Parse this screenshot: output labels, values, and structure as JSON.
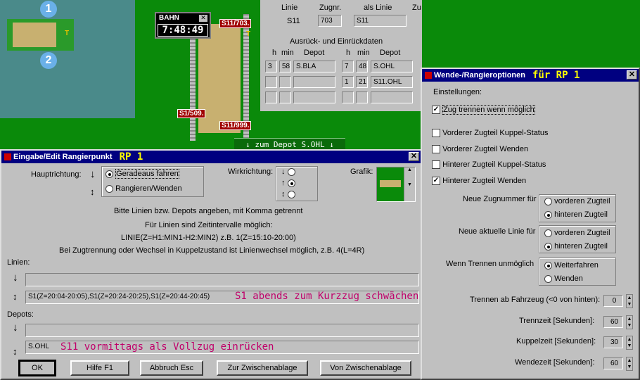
{
  "map": {
    "marker1": "1",
    "marker2": "2",
    "t1": "T",
    "t2": "T",
    "sig1": "S11/703.",
    "sig2": "S1/509.",
    "sig3": "S11/999."
  },
  "clock": {
    "title": "BAHN",
    "time": "7:48:49"
  },
  "depot_banner": "↓ zum Depot S.OHL ↓",
  "linie_panel": {
    "col_linie": "Linie",
    "col_zugnr": "Zugnr.",
    "col_als": "als Linie",
    "col_zu": "Zu",
    "linie_val": "S11",
    "zugnr_val": "703",
    "als_val": "S11",
    "ausruck_title": "Ausrück- und Einrückdaten",
    "h": "h",
    "min": "min",
    "depot": "Depot",
    "left_rows": [
      {
        "h": "3",
        "min": "58",
        "depot": "S.BLA"
      },
      {
        "h": "",
        "min": "",
        "depot": ""
      },
      {
        "h": "",
        "min": "",
        "depot": ""
      }
    ],
    "right_rows": [
      {
        "h": "7",
        "min": "48",
        "depot": "S.OHL"
      },
      {
        "h": "1",
        "min": "21",
        "depot": "S11.OHL"
      },
      {
        "h": "",
        "min": "",
        "depot": ""
      }
    ]
  },
  "edit": {
    "title": "Eingabe/Edit Rangierpunkt",
    "title_hl": "RP 1",
    "hauptrichtung": "Hauptrichtung:",
    "opt_gerade": "Geradeaus fahren",
    "opt_rangieren": "Rangieren/Wenden",
    "wirkrichtung": "Wirkrichtung:",
    "grafik": "Grafik:",
    "info1": "Bitte Linien bzw. Depots angeben, mit Komma getrennt",
    "info2": "Für Linien sind Zeitintervalle möglich:",
    "info3": "LINIE(Z=H1:MIN1-H2:MIN2) z.B. 1(Z=15:10-20:00)",
    "info4": "Bei Zugtrennung oder Wechsel in Kuppelzustand ist Linienwechsel möglich, z.B. 4(L=4R)",
    "linien_label": "Linien:",
    "linien_top": "",
    "linien_bottom": "S1(Z=20:04-20:05),S1(Z=20:24-20:25),S1(Z=20:44-20:45)",
    "linien_note": "S1 abends zum Kurzzug schwächen",
    "depots_label": "Depots:",
    "depots_top": "",
    "depots_bottom": "S.OHL",
    "depots_note": "S11 vormittags als Vollzug einrücken",
    "btn_ok": "OK",
    "btn_hilfe": "Hilfe     F1",
    "btn_abbruch": "Abbruch   Esc",
    "btn_zw": "Zur Zwischenablage",
    "btn_von": "Von Zwischenablage"
  },
  "wende": {
    "title": "Wende-/Rangieroptionen",
    "title_hl": "für RP 1",
    "einstellungen": "Einstellungen:",
    "chk_trennen": "Zug trennen wenn möglich",
    "chk_vorderer_kuppel": "Vorderer Zugteil Kuppel-Status",
    "chk_vorderer_wenden": "Vorderer Zugteil Wenden",
    "chk_hinterer_kuppel": "Hinterer Zugteil Kuppel-Status",
    "chk_hinterer_wenden": "Hinterer Zugteil Wenden",
    "zugnr_label": "Neue Zugnummer für",
    "zugnr_opt1": "vorderen Zugteil",
    "zugnr_opt2": "hinteren Zugteil",
    "linie_label": "Neue aktuelle Linie für",
    "linie_opt1": "vorderen Zugteil",
    "linie_opt2": "hinteren Zugteil",
    "unmoeglich_label": "Wenn Trennen unmöglich",
    "unm_opt1": "Weiterfahren",
    "unm_opt2": "Wenden",
    "trennen_ab": "Trennen ab Fahrzeug (<0 von hinten):",
    "trennen_ab_val": "0",
    "trennzeit": "Trennzeit  [Sekunden]:",
    "trennzeit_val": "60",
    "kuppelzeit": "Kuppelzeit  [Sekunden]:",
    "kuppelzeit_val": "30",
    "wendezeit": "Wendezeit  [Sekunden]:",
    "wendezeit_val": "60"
  }
}
